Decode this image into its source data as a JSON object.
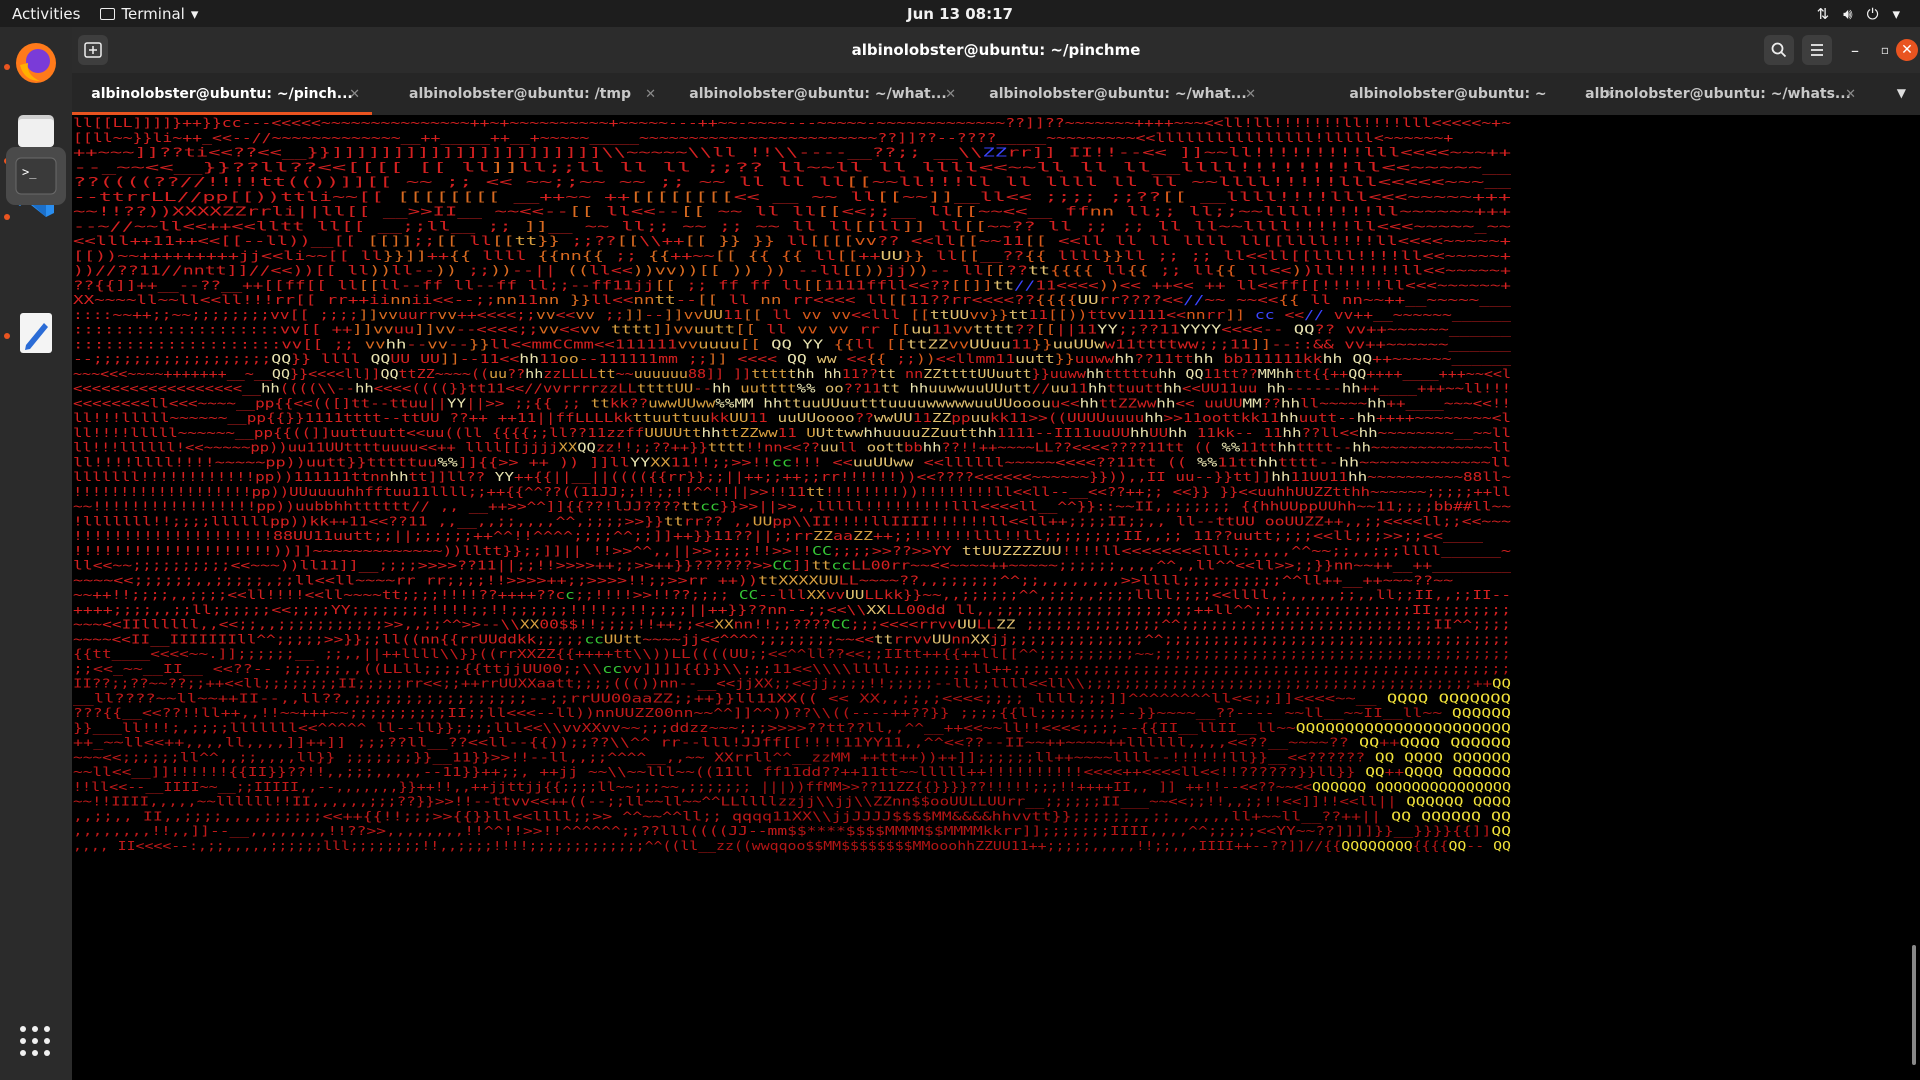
{
  "topbar": {
    "activities": "Activities",
    "app_name": "Terminal",
    "clock": "Jun 13  08:17"
  },
  "window": {
    "title": "albinolobster@ubuntu: ~/pinchme"
  },
  "tabs": [
    {
      "label": "albinolobster@ubuntu: ~/pinch...",
      "active": true
    },
    {
      "label": "albinolobster@ubuntu: /tmp",
      "active": false
    },
    {
      "label": "albinolobster@ubuntu: ~/what...",
      "active": false
    },
    {
      "label": "albinolobster@ubuntu: ~/what...",
      "active": false
    },
    {
      "label": "albinolobster@ubuntu: ~",
      "active": false
    },
    {
      "label": "albinolobster@ubuntu: ~/whats...",
      "active": false
    }
  ],
  "dock": {
    "items": [
      "firefox-icon",
      "files-icon",
      "vscode-icon",
      "terminal-icon",
      "text-editor-icon"
    ]
  },
  "terminal": {
    "art_text": "ll[[LL]]]]}++}}cc---<<<<<~~~~~~~~~~~~~~~++~+~~~~~~~~~~+~~~~~---++~~-~~~~---~~~~~-~~~~~~~~~~~~~??]]??~~~~~~~++++~~~<<ll!ll!!!!!!!ll!!!!lll<<<<<~+~\n[[ll~~}}li~++_<<--//~~~~~~~~~~~~~__++_____++__+~~~~~_____~~~~~~~~~~~~~~~~~~~~~~~~??]]??--????_____~~~~~~~~~<<llllllllllllllll!lllll<~~~~~~+\n++~~~]]??ti<<??<<__}}]]]]]]]]]]]]]]]]]]]]]]\\\\~~~~~\\\\ll          !!\\\\----__??;;          __\\\\ZZrr]]           II!!--<<         ]]~~ll!!!!!!!!!lll<<<<~~~++\n--_~~<<__}}??ll??<<[[[[  [[     ll]]ll;;ll                ll                  ll ;;?? ll~~ll   ll  llll<<~~ll   ll    ll__llll!!!!!!!!ll<<~~~~~__\n??((((??//!!!!tt(())]][[  ~~   ;;     <<    ~~;;~~       ~~ ;;   ~~           ll   ll   ll[[~~ll!!!ll  ll  llll  ll  ll  ~~llll!!!!!lll<<<<<~~~__\n--ttrrLL//pp[[))ttli~~[[      [[[[[[[[      __++~~      ++[[[[[[[[<<  __  ~~          ll[[~~]]__ll<<  ;;;;  ;;??[[        __llll!!!!lll<<<~~~~~+++\n~~!!??))XXXXZZrrli||ll[[      __>>II__   ~~<<--[[       ll<<--[[  ~~  ll    ll[[<<;;__  ll[[~~<<__        ffnn    ll;;   ll;;~~llll!!!!!ll~~~~~~+++\n--~//~~ll<<++<<lltt ll[[      __;;ll__   ;;  ]]__   ~~  ll;;  ~~  ;;  ~~  ll  ll[[ll]]  ll[[~~??  ll          ;;  ;;  ll  ll~~llll!!!!!ll<<<~~~~~_~~\n<<lll++11++<<[[--ll))__[[     [[]];;[[    ll[[tt}}    ;;??[[\\\\++[[    }}  }}    ll[[[[vv??  <<ll[[~~11[[   <<ll    ll    ll  llll  ll[[llll!!!!ll<<<<~~~~~+\n[[))~~+++++++++jj<<li~~[[   ll}}]]++{{   llll  {{nn{{   ;;  {{++~~[[    {{  {{    ll[[++UU}}    ll[[__??{{  llll}}ll  ;;    ;;    ll<<ll[[llll!!!!ll<<~~~~~+\n))//??11//nntt]]//<<))[[    ll))ll--))   ;;))--||   ((ll<<))vv))[[    ))  ))  --ll[[))jj))--  ll[[??tt{{{{  ll{{   ;;  ll{{   ll<<))ll!!!!!!ll<<~~~~~+\n??{{]]++__--??__++[[ff[[    ll[[ll--ff   ll--ff   ll;;--ff11jj[[   ;;  ff  ff  ll[[1111ffll<<??[[]]tt//11<<<<))<<  ++<<  ++  ll<<ff[[!!!!!!ll<<<~~~~~~+\nXX~~~~ll~~ll<<ll!!!rr[[    rr++iinnii<<--;;nn11nn  }}ll<<nntt--[[  ll  nn  rr<<<<  ll[[11??rr<<<<??{{{{UUrr????<<//~~    ~~<<{{  ll    nn~~++__~~~~~___\n::::~~++;;~~;;;;;;;;vv[[  ;;;;]]vvuurrvv++<<<<;;vv<<vv  ;;]]--]]vvUU11[[  ll  vv  vv<<lll  [[ttUUvv}}tt11[[))ttvv1111<<nnrr]]   cc  <<//    vv++__~~~~~~______\n::::::::::::::::::::vv[[  ++]]vvuu]]vv--<<<<;;vv<<vv  tttt]]vvuutt[[  ll  vv  vv    rr  [[uu11vvtttt??[[||11YY;;??11YYYY<<<<--      QQ??    vv++~~~~~~______\n::::::::::::::::::::vv[[  ;;  vvhh--vv--}}ll<<mmCCmm<<111111vvuuuu[[      QQ  YY  {{ll  [[ttZZvvUUuu11}}uuUUww11ttttww;;;11]]--::&&      vv++~~~~~~______\n--;;;;;;;;;;;;;;;;;;QQ}}  llll  QQUU  UU]]--11<<hh11oo--111111mm  ;;]]  <<<<  QQ  ww  <<{{  ;;))<<llmm11uutt}}uuwwhh??11tthh  bb111111kkhh        QQ++~~~~~~______\n~~~<<<~~~~+++++++__~__QQ}}<<<<ll]]QQttZZ~~~~((uu??hhzzLLLLtt~~uuuuuu88]]  ]]ttttthh  hh11??tt  nnZZttttUUuutt}}uuwwhhtttttuhh  QQ11tt??MMhhtt{{++QQ++++____+++~~<<l\n<<<<<<<<<<<<<<<<<<__hh((((\\\\--hh<<<<((((}}tt11<<//vvrrrrzzLLttttUU--hh  uutttt%%  oo??11tt  hhuuwwuuUUutt//uu11hhttuutthh<<UU11uu    hh------hh++____+++~~ll!!!\n<<<<<<<<ll<<<~~~~__pp{{<<(([]tt--ttuu||YY||>>  ;;{{     ;;  ttkk??uwwUUww%%MM  hhttuuUUuutttuuuuwwwwwuuUUooouu<<hhttZZwwhh<<  uuUUMM??hhll~~~~~hh++____~~~<<!!\nll!!!lllll~~~~~~__pp{{}}1111tttt--ttUU    ??++    ++11||ffLLLLkkttuuttuukkUU11  uuUUoooo??wwUU11ZZppuukk11>>((UUUUuuuuhh>>11oottkk11hhuutt--hh++++~~~~~~~~<l\nll!!!!lllll~~~~~~__pp{{((]]uuttuutt<<uu((ll  {{{{;;ll??11zzffUUUUtthhttZZww11  UUttwwhhuuuuZZuutthh1111--II11uuUUhhUUhh  11kk--  11hh??ll<<hh~~~~~~~~__~~ll\nll!!!llllll!<<~~~~~pp))uu11UUttttuuuu<<++   llll[[jjjjXXQQzz!!;;??++}}tttt!!nn<<??uull oottbbhh??!!++~~~~LL??<<<<????11tt  ((  %%11tthhtttt--hh~~~~~~~~~~~~~ll\nll!!!!llll!!!!~~~~~pp))uutt}}tttttuu%%]]{{>>  ++  ))  ]]llYYXX11!!;;>>!!cc!!!  <<uuUUww  <<llllll~~~~~<<<<??11tt  ((  %%11tthhtttt--hh~~~~~~~~~~~~~ll\nlllllll!!!!!!!!!!!!pp))111111ttnnhhtt]]ll??  YY++{{||__||(((({{rr}};;||++;;++;;rr!!!!!!))<<????<<<<<<~~~~~~}})),,II  uu--}}tt]]hh11UU11hh~~~~~~~~~~88ll~\n!!!!!!!!!!!!!!!!!!!pp))UUuuuuhhfftuu11llll;;++{{^^??((11JJ;;!!;;!!^^!!||>>!!11tt!!!!!!!!))!!!!!!!!ll<<ll--__<<??++;;  <<}}  }}<<uuhhUUZZtthh~~~~~~;;;;;++ll\n~~!!!!!!!!!!!!!!!!!pp))uubbhhtttttt//  ,, __++>>^^]]{{??!lJJ????ttcc}}>>||>>,,lllll!!!!!!!!!lll<<<<ll__^^}}::~~II,;;;;;;;  {{hhUUppUUhh~~11;;;;bb##ll~~\n!lllllll!!;;;;llllllpp))kk++11<<??11  ,,__,,;;,,,,^^,;;;;>>}}ttrr??  ,,UUpp\\\\II!!!!llIIII!!!!!!ll<<ll++;;;;II;;,,  ll--ttUU  ooUUZZ++,,;;<<<<ll;;<<~~~\n!!!!!!!!!!!!!!!!!!!!88UU11uutt;;||;;;;;;++^^!!^^^^;;;;^^;;]]++}}11??||;;rrZZaaZZ++;;!!!!!!lll!!ll;;;;;;;;II,,;;  11??uutt;;;;<<ll;;;>>;;<<____\n!!!!!!!!!!!!!!!!!!!!))]]~~~~~~~~~~~~~))lltt}};;]]||  !!>>^^,,||>>;;;;!!>>!!CC;;;;>>??>>YY  ttUUZZZZUU!!!!ll<<<<<<<<lll;;,,,,^^~~;;,,;;;llll______~\nll<<~~;;;;;;;;;;<<~~~))ll11]]__;;;;>>>>??11||;;!!>>>>++;;>>++}}??????>>CC]]ttccLL00rr~~<<~~~~++~~~~~;;;;;;,,,,^^,,ll^^<<ll>>;;}}nn~~++__++________\n~~~~<<;;;;;;,,;;;;;,;;ll<<ll~~~~rr  rr;;;;!!>>>>++;;>>>>!!;;>>rr  ++))ttXXXXUULL~~~~??,,;;;;;;^^;;,,,,,,,,>>llll;;;;;;;;;;^^ll++__++~~~??~~\n~~++!!;;;;,,;;;;<<ll!!!!<<ll~~~~tt;;;;!!!!??++++??cc;;!!!!>>!!??;;;;  CC--lllXXvvUULLkk}}~~,,;;;;;;^^,;;;,,;;;;llll;;;;<<llll,;,,,,,;;,,ll;;II,,;;II--\n++++;;;;,,;;ll;;;;;;<<;;;;YY;;;;;;;;!!!!;;!!;;;;;;!!!!;;!!;;;;||++}}??nn--;;<<\\\\XXLL00dd    ll,,;;;;;;;;;;;;;;;;;;;;++ll^^;;;;;;;;;;;;;;;;II;;;;;;;;\n~~~<<IIllllll,,<<;;,,;;;;;;;;;;;>>,,;;^^>>--\\\\XX00$$!!;;;;!!++;;<<XXnn!!;;????CC;;;<<<<rrvvUULLZZ  ;;;;;;;;;;;;;;^^;;;;;;;;;;;;;;;;;;;;;;;;;;II^^;;;;\n~~~~<<II__IIIIIIIll^^;;;;;>>}};;ll((nn{{rrUUddkk;;;;;ccUUtt~~~~jj<<^^^^;;;;;;;;~~<<ttrrvvUUnnXXjj;;;;;;;;;;;;;;^^;;;;;;;;;;;;;;;;;;;;;;;;;;;;;;;;;;;;\n{{tt____<<<<~~.]];;;;;;__  ;;,,||++llll\\\\}}((rrXXZZ{{++++tt\\\\))LL((((UU;;<<^^ll??<<;;IItt++{{++ll[[^^;;;;;;;;;;~~;;;;;;;;;;;;;;;;;;;;;;;;;;;;;;;;;;;;;\n;;<<_~~__II__   <<??--  ;;;;;;,,((LLll;;;;{{ttjjUU00;;\\\\ccvv]]]]{{}}\\\\;;;11<<\\\\\\\\llll;;;;;;;;ll++;;;;;;;;;;;;;;;;;;;;;;;;;;;;;;;;;;;;;;;;;;;;;;;;;;\nII??;;??~~??;;++<<ll;;;;;;;;II;;;;;rr<<;;++rrUUXXaatt;;;;((())nn--__<<jjXX;;<<jj;;;;!!;;;;;--ll;;llll<<ll\\\\;;;;;;;;;;;;;;;;;;;;;;;;;;;;;;;;;;;;;;;;;++QQ\n__ll????~~ll~~++II--,,ll??,;;;;;;;;;;;;;;;;;--;;rrUU00aaZZ;;++}}ll11XX((  <<  XX,,;;,;<<<<;;;;  llll;;;]]^^^^^^^^ll<<;;]]<<<<~~__  QQQQ        QQQQQQQ\n???{{__<<??!!ll++,,!!~~+++~~;;;;;;;;;;II;;ll<<<--ll))nnUUZZ00nn~~^^]]^^))??\\\\((----++??}}  ;;;;{{ll;;;;;;;;--}}~~~~__??----  ~~ll__~~II__ll~~      QQQQQQ\n}}___ll!!!;,;;;;lllllll<<^^^^^  ll--ll}};;;;lll<<\\\\vvXXvv~~;;;ddzz~~~;;;>>>>??tt??ll,,^^__++<<~~ll!!<<<<;;;;--{{II__llII__ll~~QQQQQQQQQQQQQQQQQQQQQQ\n++_~~ll<<++,,,,ll,,,,]]++]]  ;;;??ll__??<<ll--{{));;??\\\\^^  rr--lll!JJff[[!!!!11YY11,,^^<<??--II~~++~~~~++llllll,,,,<<??__~~~~??  QQ++QQQQ      QQQQQQ\n~~~<<;;;;;;ll^^,,;;,,,,ll}}  ;;;;;;;}}__11}}>>!!--ll,,;;^^^^__,,~~  XXrrll^^__zzMM  ++tt++))++]];;;;;;ll++~~~~llll--!!!!!!ll}}__<<??????  QQ  QQQQ      QQQQQQ\n~~ll<<__]]!!!!!!{{II}}??!!,,;;;,,,,,--11}}++;;,  ++jj  ~~\\\\~~lll~~((11ll  ff11dd??++11tt~~lllll++!!!!!!!!!!<<<<++<<<<ll<<!!??????}}ll}}  QQ++QQQQ      QQQQQQ\n!!ll<<--__IIII~~__;;IIIII,,--,,,,,,,}}++!!,,++jjttjj{{;;;;ll~~;;;~~,;;;;;;;  |||))ffMM>>??11ZZ{{}}}}??!!!!!;;;!!++++II,,  ]]  ++!!--<<??~~<<QQQQQQ   QQQQQQQQQQQQQQQ\n~~!!IIII,,,,,~~llllll!!II,,,,,,;;;??}}>>!!--ttvv<<++((--;;ll~~ll~~^^LLllllzzjj\\\\jj\\\\ZZnn$$ooUULLUUrr__;;;;;;II___~~<<;;!!,,;;!!<<]]!!<<ll||  QQQQQQ      QQQQ\n,,;;,,  II,,;;;;,,,,;;;;;;<<++{{!!;;;>>{{}}ll<<llll;;>>    ^^~~^^ll;;  qqqq11XX\\\\jjJJJJ$$$$MM&&&&hhvvtt}};;;;;;,,;;,,,,,,ll+~~ll__??++||  QQ  QQQQQQ   QQ\n,,,,,,,,!!,,]]--__,,,,,,,,!!??>>,,,,,,,,!!^^!!>>!!^^^^^^;;??lll((((JJ--mm$$****$$$$MMMM$$MMMMkkrr]];;;;;;;IIII,,,,^^;;;;;<<YY~~??]]]]}}__}}}}{{]]QQ\n,,,,  II<<<<--:,;;,,,,,;;;;;;lll;;;;;;;;!!,,;;;;!!!!;;;;;;;;;;;;;^^((ll__zz((wwqqoo$$MM$$$$$$$$MMooohhZZUU11++;;;;;,,,,,!!;;,,,IIII++--??]]//{{QQQQQQQQ{{{{QQ--  QQ"
  }
}
